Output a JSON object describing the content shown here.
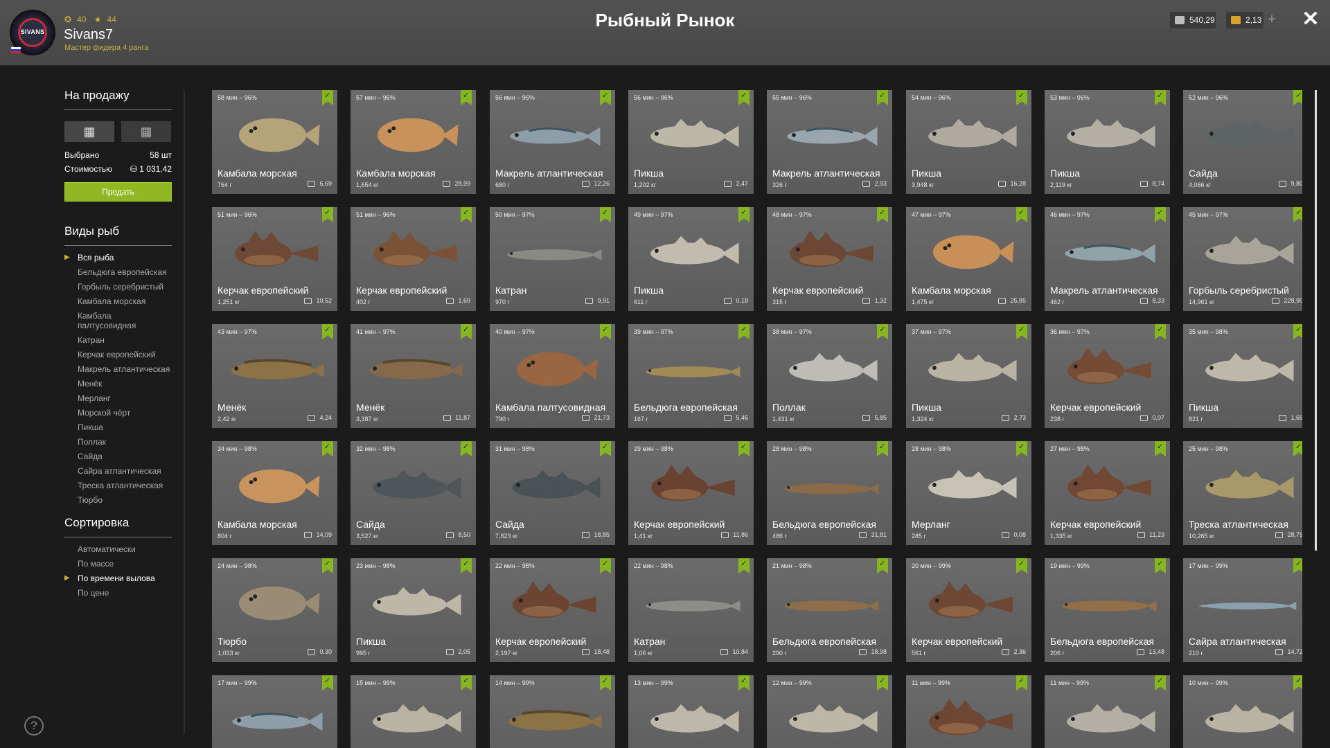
{
  "header": {
    "stat1": "40",
    "stat2": "44",
    "username": "Sivans7",
    "rank": "Мастер фидера 4 ранга",
    "avatar_text": "SIVANS",
    "title": "Рыбный Рынок",
    "silver": "540,29",
    "gold": "2,13",
    "plus": "+",
    "close": "✕"
  },
  "sidebar": {
    "for_sale_title": "На продажу",
    "selected_label": "Выбрано",
    "selected_value": "58 шт",
    "cost_label": "Стоимостью",
    "cost_value": "1 031,42",
    "sell_label": "Продать",
    "species_title": "Виды рыб",
    "species": [
      {
        "label": "Вся рыба",
        "selected": true
      },
      {
        "label": "Бельдюга европейская"
      },
      {
        "label": "Горбыль серебристый"
      },
      {
        "label": "Камбала морская"
      },
      {
        "label": "Камбала палтусовидная"
      },
      {
        "label": "Катран"
      },
      {
        "label": "Керчак европейский"
      },
      {
        "label": "Макрель атлантическая"
      },
      {
        "label": "Менёк"
      },
      {
        "label": "Мерланг"
      },
      {
        "label": "Морской чёрт"
      },
      {
        "label": "Пикша"
      },
      {
        "label": "Поллак"
      },
      {
        "label": "Сайда"
      },
      {
        "label": "Сайра атлантическая"
      },
      {
        "label": "Треска атлантическая"
      },
      {
        "label": "Тюрбо"
      }
    ],
    "sort_title": "Сортировка",
    "sort": [
      {
        "label": "Автоматически"
      },
      {
        "label": "По массе"
      },
      {
        "label": "По времени вылова",
        "selected": true
      },
      {
        "label": "По цене"
      }
    ],
    "help": "?"
  },
  "fish": [
    {
      "time": "58 мин – 96%",
      "name": "Камбала морская",
      "weight": "764 г",
      "price": "6,69",
      "shape": "flat",
      "color": "#b5a37a"
    },
    {
      "time": "57 мин – 96%",
      "name": "Камбала морская",
      "weight": "1,654 кг",
      "price": "28,99",
      "shape": "flat",
      "color": "#c9925a"
    },
    {
      "time": "56 мин – 96%",
      "name": "Макрель атлантическая",
      "weight": "680 г",
      "price": "12,26",
      "shape": "slim",
      "color": "#8d9ea8"
    },
    {
      "time": "56 мин – 96%",
      "name": "Пикша",
      "weight": "1,202 кг",
      "price": "2,47",
      "shape": "cod",
      "color": "#bdb7a8"
    },
    {
      "time": "55 мин – 96%",
      "name": "Макрель атлантическая",
      "weight": "326 г",
      "price": "2,93",
      "shape": "slim",
      "color": "#9aa6ad"
    },
    {
      "time": "54 мин – 96%",
      "name": "Пикша",
      "weight": "3,948 кг",
      "price": "16,28",
      "shape": "cod",
      "color": "#aeaaa0"
    },
    {
      "time": "53 мин – 96%",
      "name": "Пикша",
      "weight": "2,119 кг",
      "price": "8,74",
      "shape": "cod",
      "color": "#b4afa4"
    },
    {
      "time": "52 мин – 96%",
      "name": "Сайда",
      "weight": "4,066 кг",
      "price": "9,80",
      "shape": "cod",
      "color": "#5e6465"
    },
    {
      "time": "51 мин – 96%",
      "name": "Керчак европейский",
      "weight": "1,251 кг",
      "price": "10,52",
      "shape": "sculpin",
      "color": "#6e4a36"
    },
    {
      "time": "51 мин – 96%",
      "name": "Керчак европейский",
      "weight": "402 г",
      "price": "1,69",
      "shape": "sculpin",
      "color": "#7a5238"
    },
    {
      "time": "50 мин – 97%",
      "name": "Катран",
      "weight": "970 г",
      "price": "9,91",
      "shape": "eel",
      "color": "#8a8a84"
    },
    {
      "time": "49 мин – 97%",
      "name": "Пикша",
      "weight": "611 г",
      "price": "0,18",
      "shape": "cod",
      "color": "#c1bcae"
    },
    {
      "time": "48 мин – 97%",
      "name": "Керчак европейский",
      "weight": "315 г",
      "price": "1,32",
      "shape": "sculpin",
      "color": "#6b4734"
    },
    {
      "time": "47 мин – 97%",
      "name": "Камбала морская",
      "weight": "1,475 кг",
      "price": "25,85",
      "shape": "flat",
      "color": "#c88f56"
    },
    {
      "time": "46 мин – 97%",
      "name": "Макрель атлантическая",
      "weight": "462 г",
      "price": "8,33",
      "shape": "slim",
      "color": "#8fa4a8"
    },
    {
      "time": "45 мин – 97%",
      "name": "Горбыль серебристый",
      "weight": "14,961 кг",
      "price": "228,90",
      "shape": "cod",
      "color": "#a8a49a"
    },
    {
      "time": "43 мин – 97%",
      "name": "Менёк",
      "weight": "2,42 кг",
      "price": "4,24",
      "shape": "ling",
      "color": "#8c7346"
    },
    {
      "time": "41 мин – 97%",
      "name": "Менёк",
      "weight": "3,387 кг",
      "price": "11,87",
      "shape": "ling",
      "color": "#86694a"
    },
    {
      "time": "40 мин – 97%",
      "name": "Камбала палтусовидная",
      "weight": "790 г",
      "price": "21,73",
      "shape": "flat",
      "color": "#9a6541"
    },
    {
      "time": "39 мин – 97%",
      "name": "Бельдюга европейская",
      "weight": "167 г",
      "price": "5,46",
      "shape": "eel",
      "color": "#a08a56"
    },
    {
      "time": "38 мин – 97%",
      "name": "Поллак",
      "weight": "1,431 кг",
      "price": "5,85",
      "shape": "cod",
      "color": "#bdbcb6"
    },
    {
      "time": "37 мин – 97%",
      "name": "Пикша",
      "weight": "1,324 кг",
      "price": "2,73",
      "shape": "cod",
      "color": "#b9b3a4"
    },
    {
      "time": "36 мин – 97%",
      "name": "Керчак европейский",
      "weight": "238 г",
      "price": "0,07",
      "shape": "sculpin",
      "color": "#744c36"
    },
    {
      "time": "35 мин – 98%",
      "name": "Пикша",
      "weight": "821 г",
      "price": "1,69",
      "shape": "cod",
      "color": "#beb8aa"
    },
    {
      "time": "34 мин – 98%",
      "name": "Камбала морская",
      "weight": "804 г",
      "price": "14,09",
      "shape": "flat",
      "color": "#c8935c"
    },
    {
      "time": "32 мин – 98%",
      "name": "Сайда",
      "weight": "3,527 кг",
      "price": "8,50",
      "shape": "cod",
      "color": "#4e5659"
    },
    {
      "time": "31 мин – 98%",
      "name": "Сайда",
      "weight": "7,823 кг",
      "price": "18,85",
      "shape": "cod",
      "color": "#4a5255"
    },
    {
      "time": "29 мин – 98%",
      "name": "Керчак европейский",
      "weight": "1,41 кг",
      "price": "11,86",
      "shape": "sculpin",
      "color": "#6a4231"
    },
    {
      "time": "28 мин – 98%",
      "name": "Бельдюга европейская",
      "weight": "486 г",
      "price": "31,81",
      "shape": "eel",
      "color": "#8a6a48"
    },
    {
      "time": "28 мин – 98%",
      "name": "Мерланг",
      "weight": "285 г",
      "price": "0,08",
      "shape": "cod",
      "color": "#c6c2b6"
    },
    {
      "time": "27 мин – 98%",
      "name": "Керчак европейский",
      "weight": "1,335 кг",
      "price": "11,23",
      "shape": "sculpin",
      "color": "#704833"
    },
    {
      "time": "25 мин – 98%",
      "name": "Треска атлантическая",
      "weight": "10,265 кг",
      "price": "28,79",
      "shape": "cod",
      "color": "#a9986a"
    },
    {
      "time": "24 мин – 98%",
      "name": "Тюрбо",
      "weight": "1,033 кг",
      "price": "0,30",
      "shape": "flat",
      "color": "#9a8c74"
    },
    {
      "time": "23 мин – 98%",
      "name": "Пикша",
      "weight": "995 г",
      "price": "2,05",
      "shape": "cod",
      "color": "#bdb7a8"
    },
    {
      "time": "22 мин – 98%",
      "name": "Керчак европейский",
      "weight": "2,197 кг",
      "price": "18,48",
      "shape": "sculpin",
      "color": "#6c4532"
    },
    {
      "time": "22 мин – 98%",
      "name": "Катран",
      "weight": "1,06 кг",
      "price": "10,84",
      "shape": "eel",
      "color": "#8c8c88"
    },
    {
      "time": "21 мин – 98%",
      "name": "Бельдюга европейская",
      "weight": "290 г",
      "price": "18,98",
      "shape": "eel",
      "color": "#8e6e4a"
    },
    {
      "time": "20 мин – 99%",
      "name": "Керчак европейский",
      "weight": "561 г",
      "price": "2,36",
      "shape": "sculpin",
      "color": "#6e4634"
    },
    {
      "time": "19 мин – 99%",
      "name": "Бельдюга европейская",
      "weight": "206 г",
      "price": "13,48",
      "shape": "eel",
      "color": "#926f49"
    },
    {
      "time": "17 мин – 99%",
      "name": "Сайра атлантическая",
      "weight": "210 г",
      "price": "14,72",
      "shape": "needle",
      "color": "#8aa0ac"
    },
    {
      "time": "17 мин – 99%",
      "name": "",
      "weight": "",
      "price": "",
      "shape": "slim",
      "color": "#8d9ea8"
    },
    {
      "time": "15 мин – 99%",
      "name": "",
      "weight": "",
      "price": "",
      "shape": "cod",
      "color": "#b9b3a4"
    },
    {
      "time": "14 мин – 99%",
      "name": "",
      "weight": "",
      "price": "",
      "shape": "ling",
      "color": "#8c7346"
    },
    {
      "time": "13 мин – 99%",
      "name": "",
      "weight": "",
      "price": "",
      "shape": "cod",
      "color": "#beb8aa"
    },
    {
      "time": "12 мин – 99%",
      "name": "",
      "weight": "",
      "price": "",
      "shape": "cod",
      "color": "#bdb7a8"
    },
    {
      "time": "11 мин – 99%",
      "name": "",
      "weight": "",
      "price": "",
      "shape": "sculpin",
      "color": "#6e4634"
    },
    {
      "time": "11 мин – 99%",
      "name": "",
      "weight": "",
      "price": "",
      "shape": "cod",
      "color": "#b4afa4"
    },
    {
      "time": "10 мин – 99%",
      "name": "",
      "weight": "",
      "price": "",
      "shape": "cod",
      "color": "#b9b3a4"
    }
  ]
}
